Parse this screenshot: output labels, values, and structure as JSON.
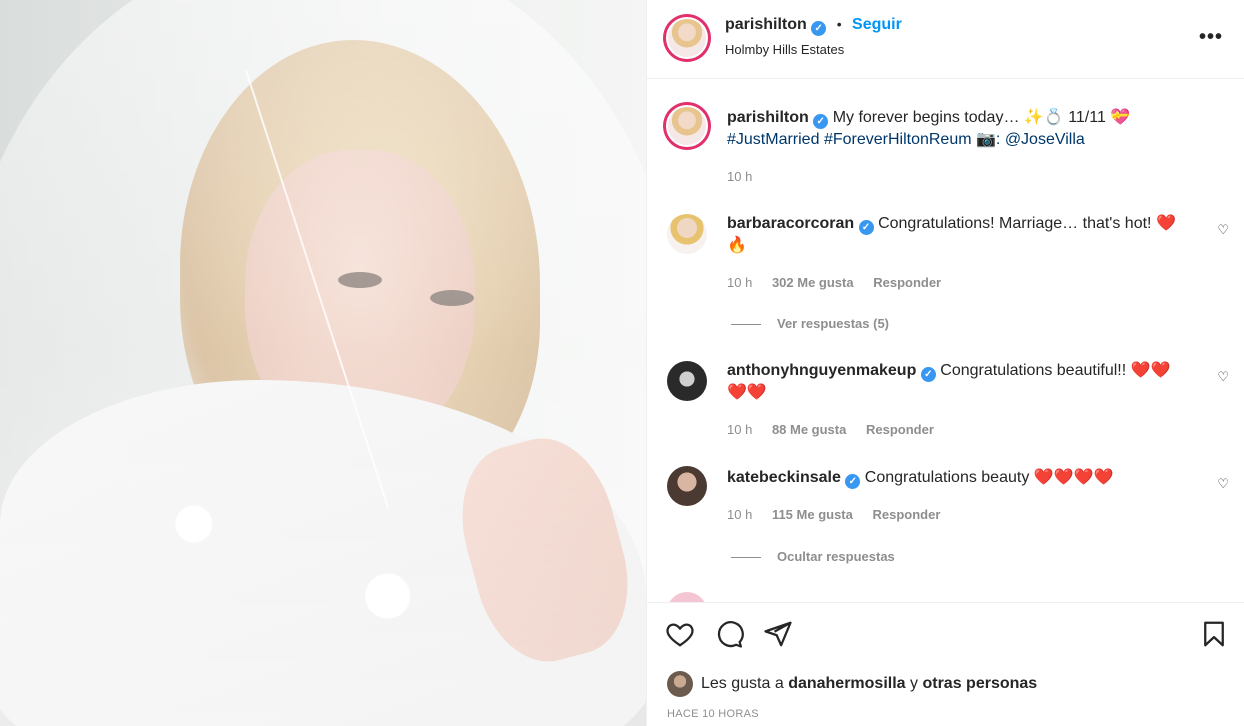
{
  "header": {
    "username": "parishilton",
    "verified_mark": "✓",
    "dot": "•",
    "follow_label": "Seguir",
    "location": "Holmby Hills Estates",
    "more_label": "•••"
  },
  "caption": {
    "username": "parishilton",
    "text_before": "My forever begins today…",
    "emojis": "✨💍",
    "date": "11/11",
    "heart_emoji": "💝",
    "hashtag1": "#JustMarried",
    "hashtag2": "#ForeverHiltonReum",
    "camera_emoji": "📷",
    "credit": ": @JoseVilla",
    "time": "10 h"
  },
  "comments": [
    {
      "username": "barbaracorcoran",
      "text": "Congratulations! Marriage… that's hot!",
      "emojis_line1": "❤️",
      "emojis_line2": "🔥",
      "time": "10 h",
      "likes": "302 Me gusta",
      "reply": "Responder",
      "replies_toggle": "Ver respuestas (5)"
    },
    {
      "username": "anthonyhnguyenmakeup",
      "text": "Congratulations beautiful!!",
      "emojis_line1": "❤️❤️",
      "emojis_line2": "❤️❤️",
      "time": "10 h",
      "likes": "88 Me gusta",
      "reply": "Responder"
    },
    {
      "username": "katebeckinsale",
      "text": "Congratulations beauty",
      "emojis_line1": "❤️❤️❤️❤️",
      "time": "10 h",
      "likes": "115 Me gusta",
      "reply": "Responder",
      "replies_toggle": "Ocultar respuestas"
    }
  ],
  "likes": {
    "prefix": "Les gusta a",
    "user": "danahermosilla",
    "conj": "y",
    "others": "otras personas"
  },
  "posted_ago": "HACE 10 HORAS",
  "colors": {
    "follow": "#0095f6",
    "verified": "#3897f0",
    "hashtag": "#00376b",
    "muted": "#8e8e8e",
    "heart": "#e0102a"
  },
  "icons": [
    "heart-icon",
    "comment-icon",
    "share-icon",
    "bookmark-icon",
    "more-icon",
    "verified-icon",
    "like-comment-icon"
  ]
}
